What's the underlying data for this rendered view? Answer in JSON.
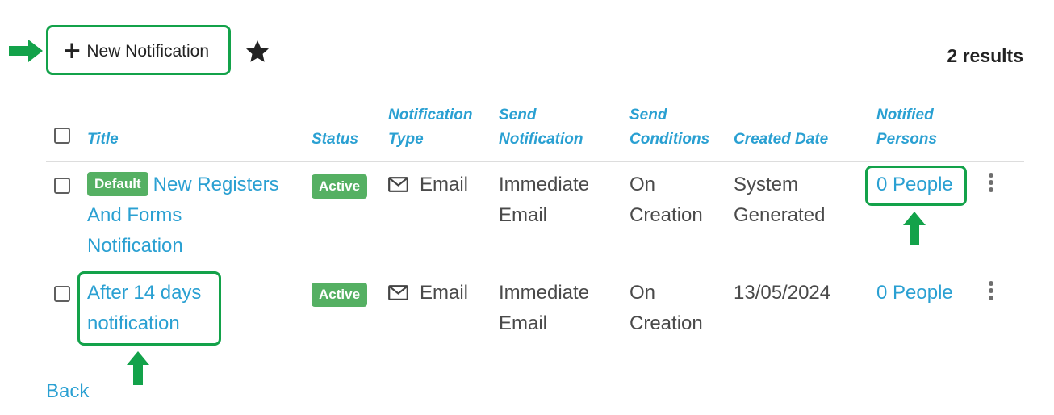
{
  "toolbar": {
    "new_notification_label": "New Notification",
    "results_text": "2 results"
  },
  "table": {
    "headers": {
      "title": "Title",
      "status": "Status",
      "notification_type": [
        "Notification",
        "Type"
      ],
      "send_notification": [
        "Send",
        "Notification"
      ],
      "send_conditions": [
        "Send",
        "Conditions"
      ],
      "created_date": "Created Date",
      "notified_persons": [
        "Notified",
        "Persons"
      ]
    },
    "rows": [
      {
        "badge": "Default",
        "title_lines": [
          "New Registers",
          "And Forms",
          "Notification"
        ],
        "status": "Active",
        "type": "Email",
        "send_notification": [
          "Immediate",
          "Email"
        ],
        "send_conditions": [
          "On",
          "Creation"
        ],
        "created_date": [
          "System",
          "Generated"
        ],
        "notified_persons": "0 People"
      },
      {
        "title_lines": [
          "After 14 days",
          "notification"
        ],
        "status": "Active",
        "type": "Email",
        "send_notification": [
          "Immediate",
          "Email"
        ],
        "send_conditions": [
          "On",
          "Creation"
        ],
        "created_date": [
          "13/05/2024"
        ],
        "notified_persons": "0 People"
      }
    ]
  },
  "footer": {
    "back_label": "Back"
  },
  "colors": {
    "link": "#2aa0d2",
    "badge_green": "#55b063",
    "highlight_green": "#13a24a"
  },
  "icons": [
    "plus-icon",
    "star-icon",
    "mail-icon",
    "kebab-menu-icon",
    "green-arrow-icon"
  ]
}
